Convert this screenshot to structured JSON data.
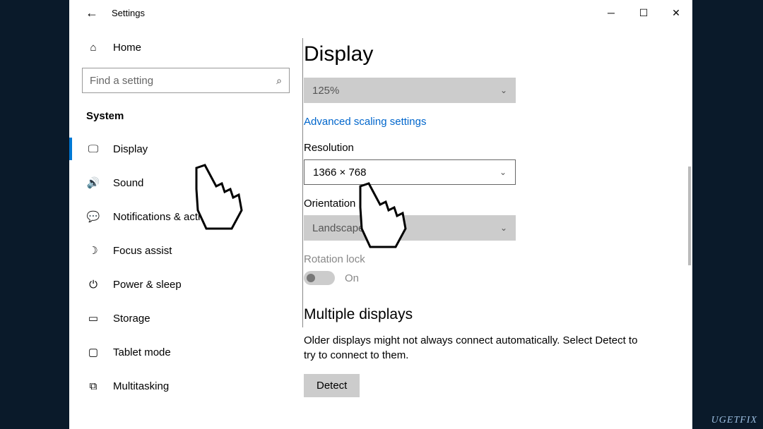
{
  "titlebar": {
    "title": "Settings"
  },
  "sidebar": {
    "home": "Home",
    "search_placeholder": "Find a setting",
    "category": "System",
    "items": [
      {
        "label": "Display"
      },
      {
        "label": "Sound"
      },
      {
        "label": "Notifications & actions"
      },
      {
        "label": "Focus assist"
      },
      {
        "label": "Power & sleep"
      },
      {
        "label": "Storage"
      },
      {
        "label": "Tablet mode"
      },
      {
        "label": "Multitasking"
      }
    ]
  },
  "content": {
    "heading": "Display",
    "scale_value": "125%",
    "advanced_link": "Advanced scaling settings",
    "resolution_label": "Resolution",
    "resolution_value": "1366 × 768",
    "orientation_label": "Orientation",
    "orientation_value": "Landscape",
    "rotation_lock_label": "Rotation lock",
    "rotation_lock_state": "On",
    "multiple_heading": "Multiple displays",
    "multiple_body": "Older displays might not always connect automatically. Select Detect to try to connect to them.",
    "detect_button": "Detect"
  },
  "watermark": "UGETFIX"
}
